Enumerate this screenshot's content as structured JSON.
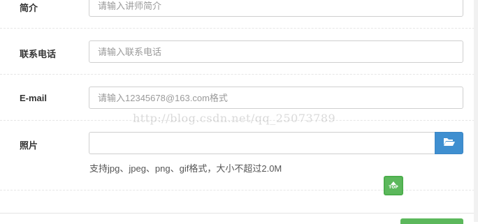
{
  "form": {
    "intro": {
      "label": "简介",
      "placeholder": "请输入讲师简介"
    },
    "phone": {
      "label": "联系电话",
      "placeholder": "请输入联系电话"
    },
    "email": {
      "label": "E-mail",
      "placeholder": "请输入12345678@163.com格式"
    },
    "photo": {
      "label": "照片",
      "value": "",
      "browse_icon": "folder-open-icon",
      "help": "支持jpg、jpeg、png、gif格式，大小不超过2.0M"
    }
  },
  "watermark": "http://blog.csdn.net/qq_25073789",
  "back_to_top": {
    "icon": "arrow-up-icon",
    "label": "TOP"
  },
  "colors": {
    "primary": "#3f8fd0",
    "success": "#5cb85c",
    "border": "#cfcfcf",
    "placeholder": "#9a9a9a"
  }
}
